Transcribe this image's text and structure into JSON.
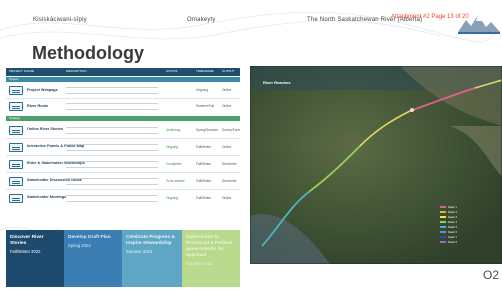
{
  "header": {
    "left": "Kisiskâciwani-sîpiy",
    "middle": "Omakeyty",
    "right": "The North Saskatchewan River (Alberta)",
    "attachment": "Attachment #2 Page 13 of 20"
  },
  "page_title": "Methodology",
  "table": {
    "columns": [
      "PROJECT PHASE",
      "DESCRIPTION",
      "STATUS",
      "TIMEFRAME",
      "OUTPUT"
    ],
    "sections": [
      "Project",
      "Strategy"
    ],
    "rows": [
      {
        "name": "Project Webpage",
        "status": "",
        "timeframe": "Ongoing",
        "output": "Online"
      },
      {
        "name": "River Route",
        "status": "",
        "timeframe": "Summer/Fall",
        "output": "Online"
      },
      {
        "name": "Online River Stories",
        "status": "Underway",
        "timeframe": "Spring/Summer",
        "output": "Survey/Form"
      },
      {
        "name": "Interactive Panels & Public Map",
        "status": "Ongoing",
        "timeframe": "Fall/Winter",
        "output": "Online"
      },
      {
        "name": "Elder & Stakeholder Workshops",
        "status": "Completed",
        "timeframe": "Fall/Winter",
        "output": "December"
      },
      {
        "name": "Stakeholder Discussion Guide",
        "status": "To be started",
        "timeframe": "Fall/Winter",
        "output": "December"
      },
      {
        "name": "Stakeholder Meetings",
        "status": "Ongoing",
        "timeframe": "Fall/Winter",
        "output": "Online"
      }
    ]
  },
  "timeline": [
    {
      "title": "Discover River Stories",
      "date": "Fall/Winter 2022"
    },
    {
      "title": "Develop Draft Plan",
      "date": "Spring 2023"
    },
    {
      "title": "Celebrate Progress & Inspire Stewardship",
      "date": "Summer 2023"
    },
    {
      "title": "Submission to Provincial & Federal governments for approval",
      "date": "Summer 2023"
    }
  ],
  "map": {
    "title": "River Reaches",
    "legend": [
      "Reach 1",
      "Reach 2",
      "Reach 3",
      "Reach 4",
      "Reach 5",
      "Reach 6",
      "Reach 7",
      "Reach 8"
    ],
    "legend_colors": [
      "#e05a9a",
      "#f2a93b",
      "#f5e23c",
      "#8fd14f",
      "#3fb6c9",
      "#6a8fd8",
      "#2b4fa8",
      "#9b6ad1"
    ]
  },
  "page_number": "O2"
}
